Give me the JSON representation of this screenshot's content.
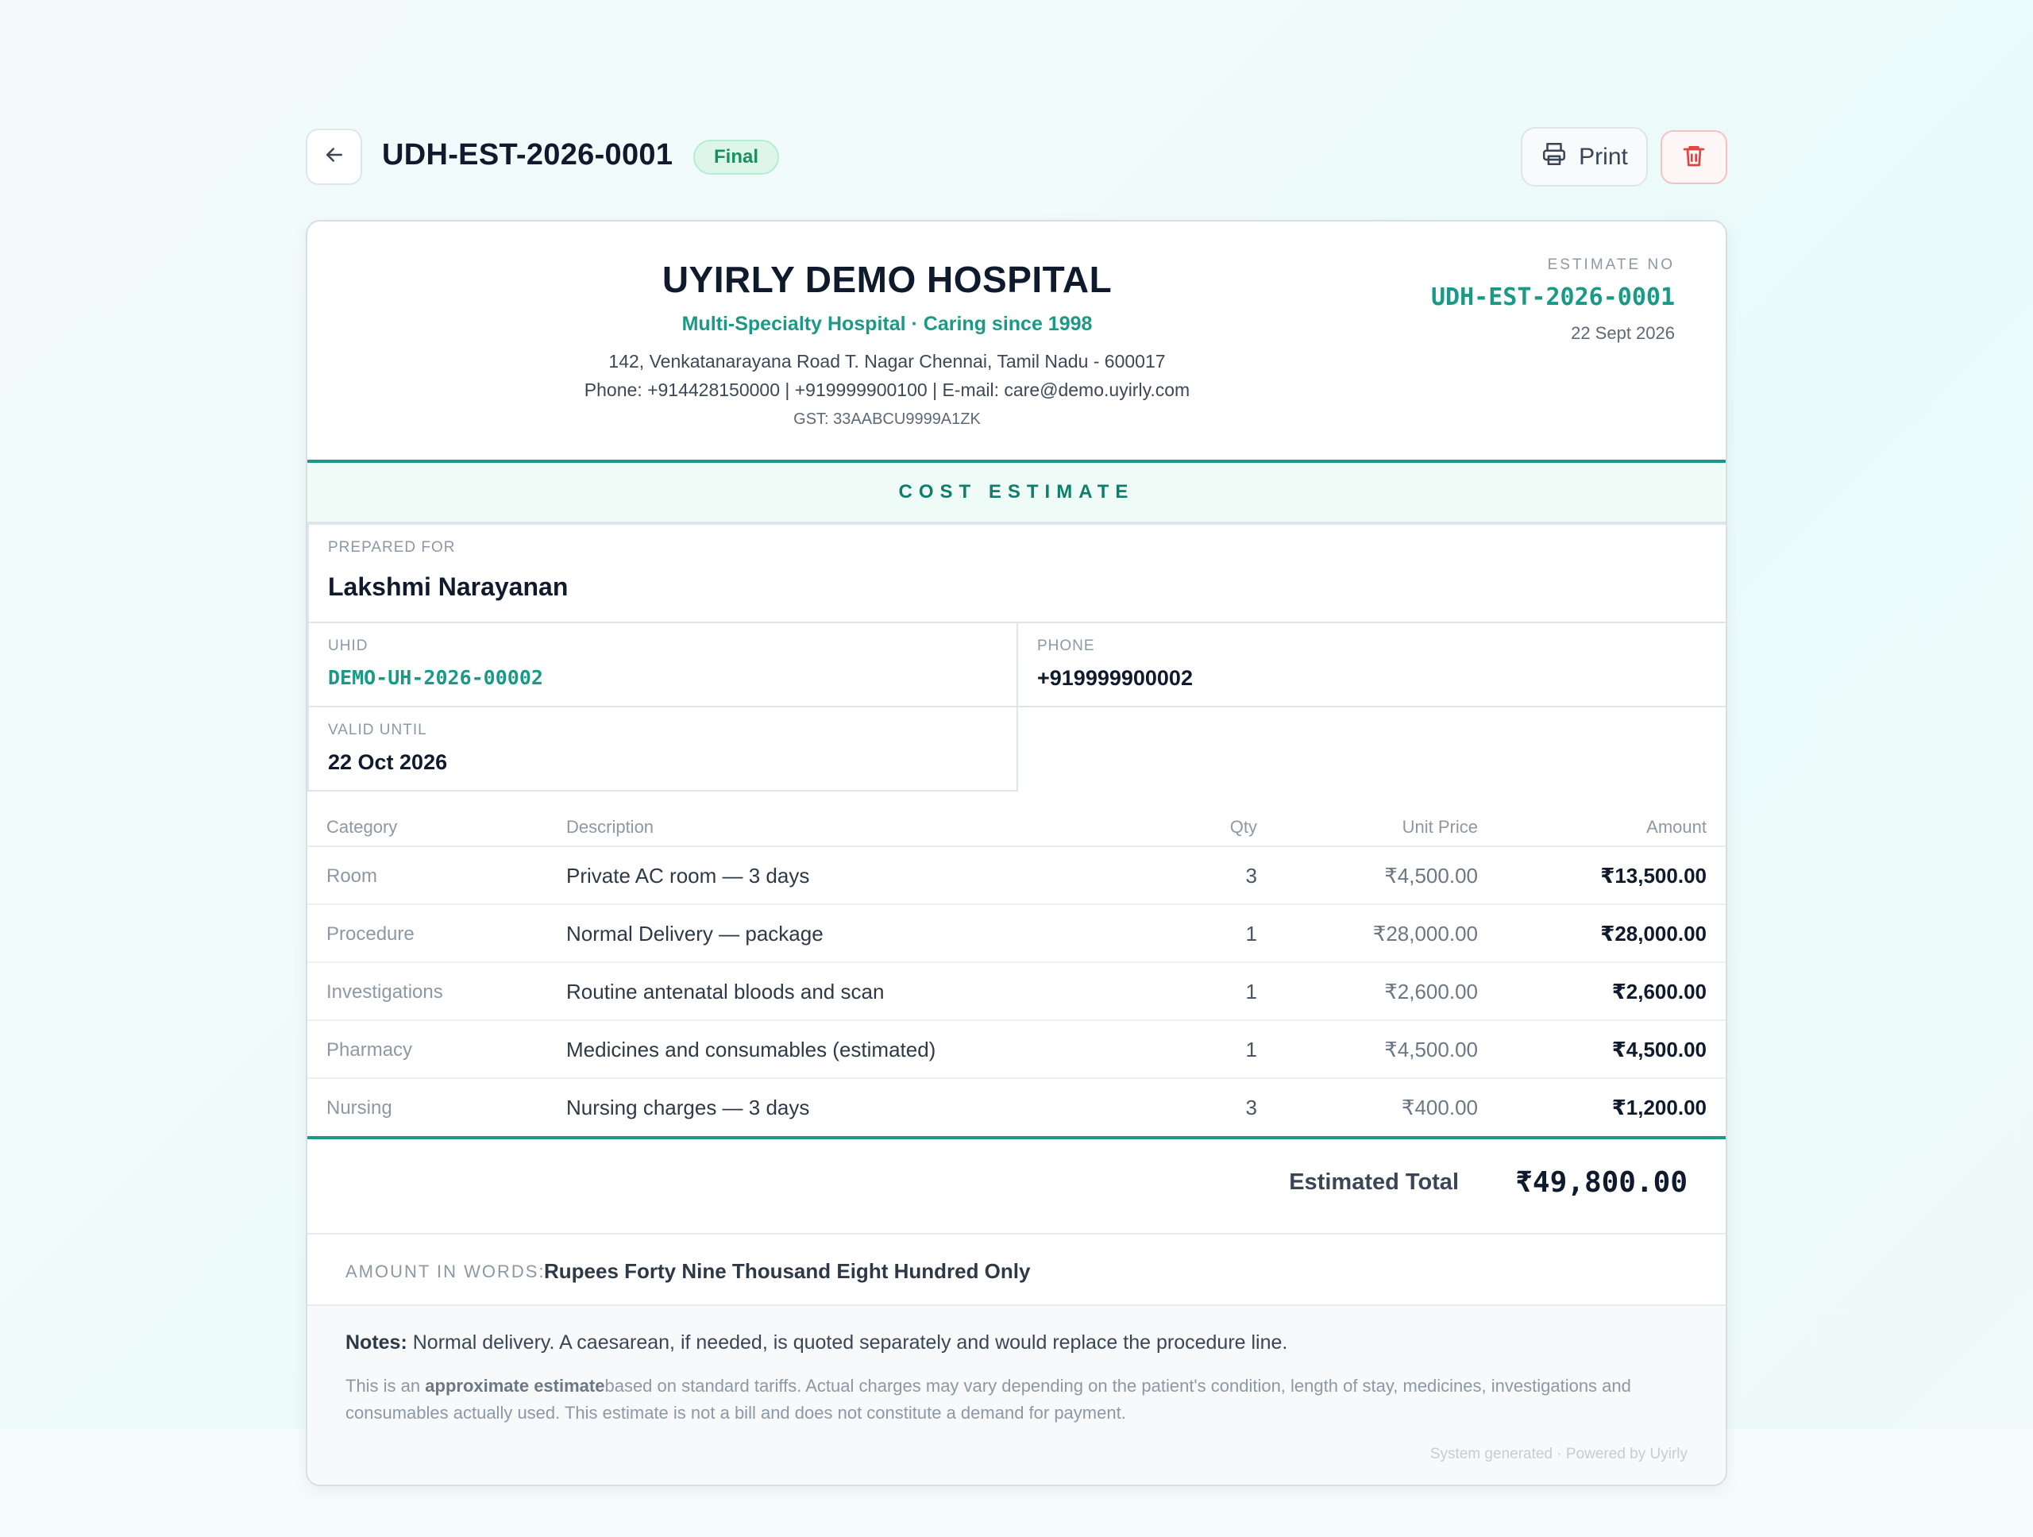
{
  "header": {
    "doc_title": "UDH-EST-2026-0001",
    "status": "Final",
    "print_label": "Print"
  },
  "hospital": {
    "name": "UYIRLY DEMO HOSPITAL",
    "tagline": "Multi-Specialty Hospital · Caring since 1998",
    "address": "142, Venkatanarayana Road T. Nagar Chennai, Tamil Nadu - 600017",
    "contact": "Phone: +914428150000 | +919999900100 | E-mail: care@demo.uyirly.com",
    "gst": "GST: 33AABCU9999A1ZK"
  },
  "estimate": {
    "label": "ESTIMATE NO",
    "number": "UDH-EST-2026-0001",
    "date": "22 Sept 2026"
  },
  "section_title": "COST ESTIMATE",
  "patient": {
    "prepared_for_label": "PREPARED FOR",
    "name": "Lakshmi Narayanan",
    "uhid_label": "UHID",
    "uhid": "DEMO-UH-2026-00002",
    "phone_label": "PHONE",
    "phone": "+919999900002",
    "valid_label": "VALID UNTIL",
    "valid_until": "22 Oct 2026"
  },
  "table": {
    "headers": {
      "category": "Category",
      "description": "Description",
      "qty": "Qty",
      "unit_price": "Unit Price",
      "amount": "Amount"
    },
    "rows": [
      {
        "category": "Room",
        "description": "Private AC room — 3 days",
        "qty": "3",
        "unit_price": "₹4,500.00",
        "amount": "₹13,500.00"
      },
      {
        "category": "Procedure",
        "description": "Normal Delivery — package",
        "qty": "1",
        "unit_price": "₹28,000.00",
        "amount": "₹28,000.00"
      },
      {
        "category": "Investigations",
        "description": "Routine antenatal bloods and scan",
        "qty": "1",
        "unit_price": "₹2,600.00",
        "amount": "₹2,600.00"
      },
      {
        "category": "Pharmacy",
        "description": "Medicines and consumables (estimated)",
        "qty": "1",
        "unit_price": "₹4,500.00",
        "amount": "₹4,500.00"
      },
      {
        "category": "Nursing",
        "description": "Nursing charges — 3 days",
        "qty": "3",
        "unit_price": "₹400.00",
        "amount": "₹1,200.00"
      }
    ]
  },
  "total": {
    "label": "Estimated Total",
    "value": "₹49,800.00"
  },
  "words": {
    "label": "AMOUNT IN WORDS:",
    "value": "Rupees Forty Nine Thousand Eight Hundred Only"
  },
  "notes": {
    "label": "Notes:",
    "text": "Normal delivery. A caesarean, if needed, is quoted separately and would replace the procedure line.",
    "disclaimer_pre": "This is an ",
    "disclaimer_bold": "approximate estimate",
    "disclaimer_post": "based on standard tariffs. Actual charges may vary depending on the patient's condition, length of stay, medicines, investigations and consumables actually used. This estimate is not a bill and does not constitute a demand for payment.",
    "powered": "System generated · Powered by Uyirly"
  },
  "colors": {
    "accent": "#1a9a86",
    "status_bg": "#def6ea",
    "danger": "#e0443e"
  },
  "icons": {
    "back": "arrow-left-icon",
    "print": "printer-icon",
    "delete": "trash-icon"
  }
}
